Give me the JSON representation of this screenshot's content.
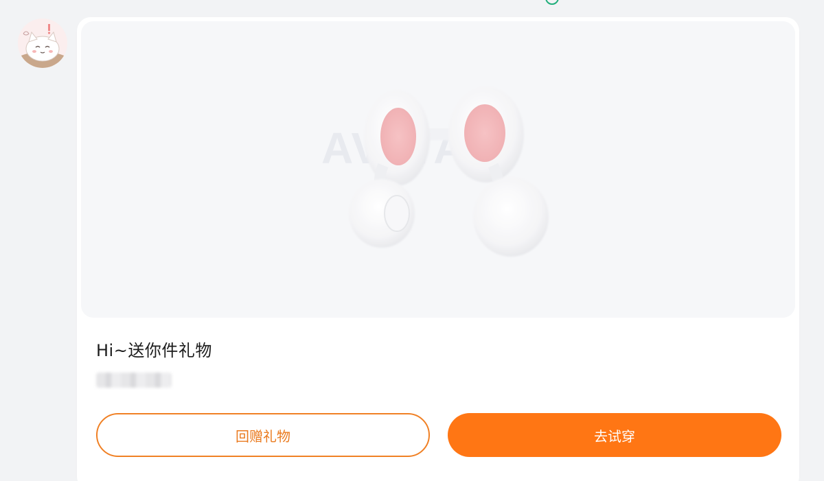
{
  "message": {
    "title": "Hi~送你件礼物",
    "watermark": "AVATAR"
  },
  "actions": {
    "return_gift_label": "回赠礼物",
    "try_on_label": "去试穿"
  },
  "colors": {
    "accent": "#ff7614",
    "outline": "#f08024",
    "status_ring": "#1fae7a"
  },
  "icons": {
    "avatar": "cartoon-cat-avatar",
    "gift": "bunny-ear-headband"
  }
}
